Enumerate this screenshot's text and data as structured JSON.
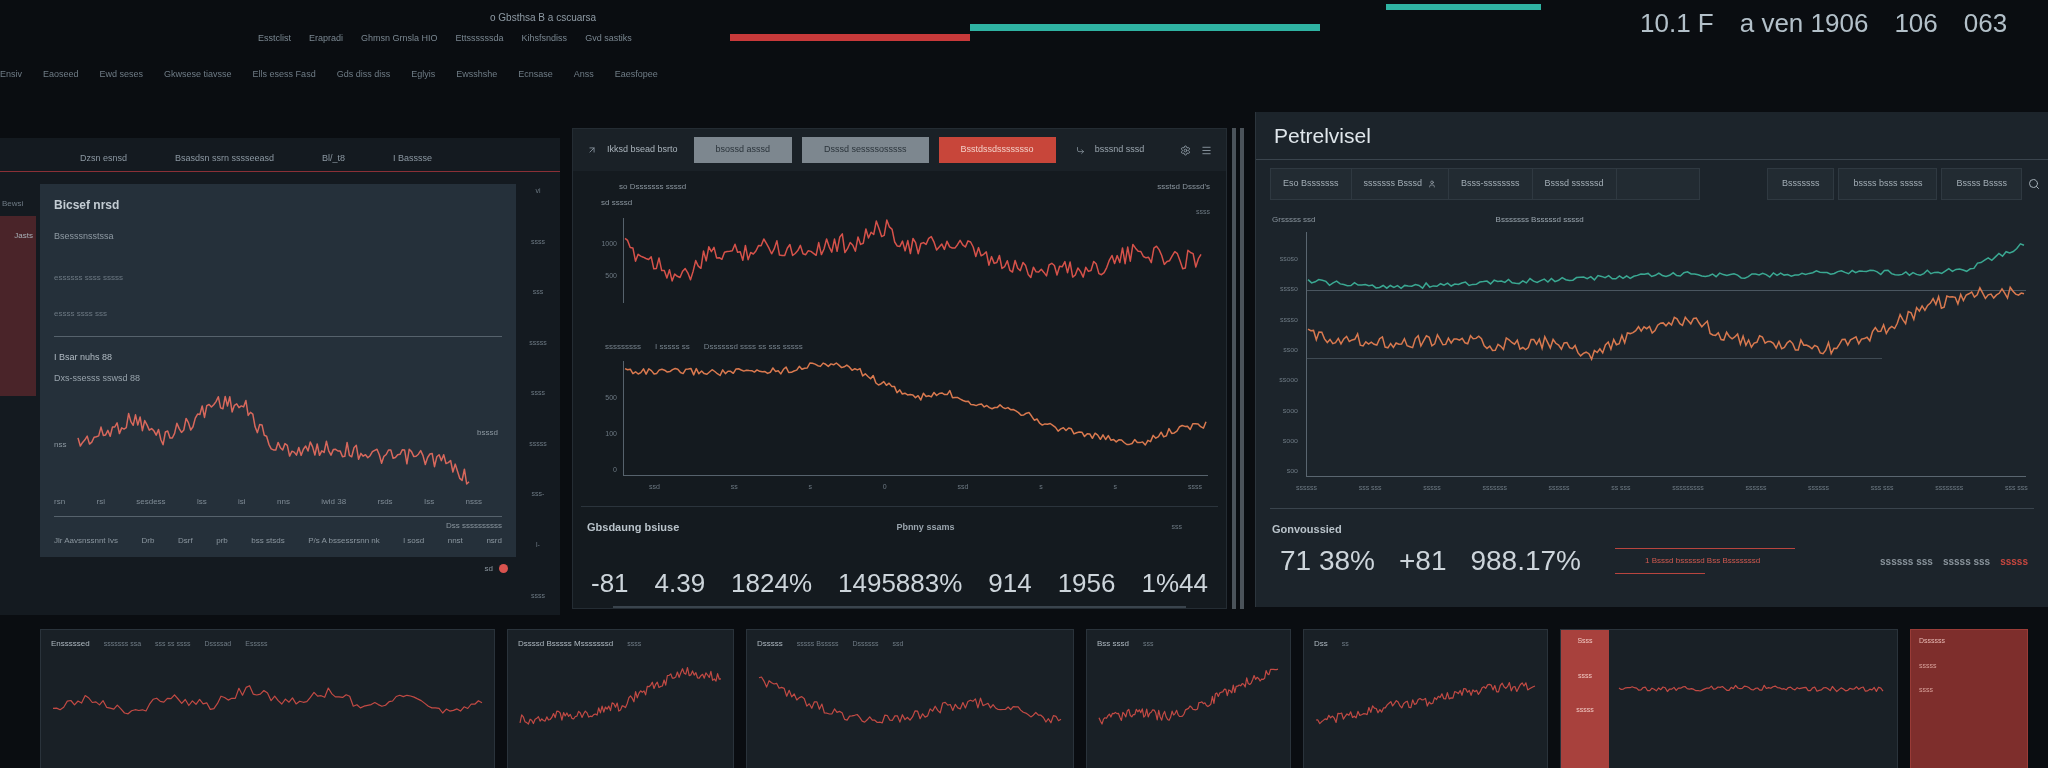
{
  "top_bar": {
    "caption": "o Gbsthsa B a cscuarsa",
    "menu_row_1": [
      "Esstclist",
      "Erapradi",
      "Ghmsn Grnsla HIO",
      "Ettssssssda",
      "Kihsfsndiss",
      "Gvd sastiks"
    ],
    "menu_row_2": [
      "Ensiv",
      "Eaoseed",
      "Ewd seses",
      "Gkwsese tiavsse",
      "Ells esess Fasd",
      "Gds diss diss",
      "Eglyis",
      "Ewsshshe",
      "Ecnsase",
      "Anss",
      "Eaesfopee"
    ],
    "readouts": [
      "10.1 F",
      "a ven 1906",
      "106",
      "063"
    ]
  },
  "left_panel": {
    "header": [
      "Dzsn esnsd",
      "Bsasdsn ssrn sssseeasd",
      "Bl/_t8",
      "I Basssse"
    ],
    "sidebar": [
      "Bewsi",
      "Jasts"
    ],
    "title": "Bicsef nrsd",
    "labels": [
      "Bsesssnsstssa",
      "essssss ssss sssss",
      "essss ssss sss"
    ],
    "chart_title": "I Bsar nuhs 88",
    "chart_caption": "Dxs-ssesss sswsd 88",
    "y_label": "nss",
    "end_label": "bsssd",
    "x_labels": [
      "rsn",
      "rsi",
      "sesdess",
      "lss",
      "isi",
      "nns",
      "iwid 38",
      "rsds",
      "Iss",
      "nsss"
    ],
    "footer_note": "Dss ssssssssss",
    "footer": [
      "Jlr Aavsnssnnt Ivs",
      "Drb",
      "Dsrf",
      "prb",
      "bss stsds",
      "P/s A bssessrsnn nk",
      "l sosd",
      "nnst",
      "nsrd"
    ],
    "axis_labels": [
      "vi",
      "ssss",
      "sss",
      "sssss",
      "ssss",
      "sssss",
      "sss-",
      "l-",
      "ssss"
    ],
    "status": "sd"
  },
  "center_panel": {
    "toolbar_title": "Ikksd bsead bsrto",
    "tabs": [
      {
        "label": "bsossd asssd",
        "selected": false
      },
      {
        "label": "Dsssd sessssosssss",
        "selected": false
      },
      {
        "label": "Bsstdssdssssssso",
        "selected": true
      }
    ],
    "toolbar_label": "bsssnd sssd",
    "chart_caption": "so Dsssssss ssssd",
    "chart_note": "ssstsd Dsssd's",
    "chart_unit": "sd ssssd",
    "chart_right_label": "ssss",
    "chart_1_y_labels": [
      "1000",
      "500"
    ],
    "chart_2_caption": [
      "sssssssss",
      "I sssss ss",
      "Dssssssd ssss ss sss sssss"
    ],
    "chart_2_y_labels": [
      "500",
      "100",
      "0"
    ],
    "x_labels": [
      "ssd",
      "ss",
      "s",
      "0",
      "ssd",
      "s",
      "s",
      "ssss"
    ],
    "summary": {
      "title": "Gbsdaung bsiuse",
      "subtitle": "Pbnny ssams",
      "note": "sss",
      "stats": [
        "-81",
        "4.39",
        "1824%",
        "1495883%",
        "914",
        "1956",
        "1%44"
      ]
    }
  },
  "right_panel": {
    "title": "Petrelvisel",
    "filters": [
      "Eso Bsssssss",
      "sssssss Bsssd",
      "Bsss-ssssssss",
      "Bsssd ssssssd"
    ],
    "buttons": [
      "Bsssssss",
      "bssss bsss sssss",
      "Bssss Bssss"
    ],
    "chart_caption": "Grsssss ssd",
    "chart_title": "Bsssssss Bsssssd ssssd",
    "y_labels": [
      "ssoso",
      "sssso",
      "sssso",
      "ssoo",
      "ssooo",
      "sooo",
      "sooo",
      "soo"
    ],
    "x_labels": [
      "ssssss",
      "sss sss",
      "sssss",
      "sssssss",
      "ssssss",
      "ss sss",
      "sssssssss",
      "ssssss",
      "ssssss",
      "sss sss",
      "ssssssss",
      "sss sss"
    ],
    "summary": {
      "title": "Gonvoussied",
      "stats": [
        "71 38%",
        "+81",
        "988.17%"
      ],
      "alert": "1 Bsssd bsssssd Bss Bsssssssd",
      "tags": [
        {
          "label": "ssssss sss",
          "color": "#8a949c"
        },
        {
          "label": "sssss sss",
          "color": "#8a949c"
        },
        {
          "label": "sssss",
          "color": "#c9473f"
        }
      ]
    }
  },
  "bottom_cards": [
    {
      "kind": "chart",
      "title": "Ensssssed",
      "meta": [
        "sssssss ssa",
        "sss ss ssss",
        "Dssssad",
        "Esssss"
      ]
    },
    {
      "kind": "chart",
      "title": "Dssssd Bsssss Msssssssd",
      "meta": [
        "ssss"
      ]
    },
    {
      "kind": "chart",
      "title": "Dsssss",
      "meta": [
        "sssss Bsssss",
        "Dssssss",
        "ssd"
      ]
    },
    {
      "kind": "chart",
      "title": "Bss sssd",
      "meta": [
        "sss"
      ]
    },
    {
      "kind": "chart",
      "title": "Dss",
      "meta": [
        "ss"
      ]
    },
    {
      "kind": "accent",
      "title": "Ssss",
      "meta": [
        "ssss",
        "sssss"
      ]
    },
    {
      "kind": "alert",
      "title": "Dssssss",
      "meta": [
        "sssss",
        "ssss"
      ]
    }
  ]
}
